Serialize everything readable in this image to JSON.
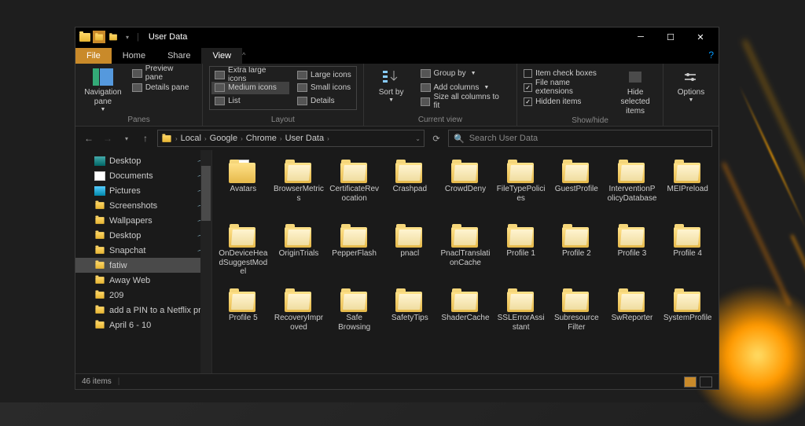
{
  "window": {
    "title": "User Data"
  },
  "tabs": {
    "file": "File",
    "home": "Home",
    "share": "Share",
    "view": "View"
  },
  "ribbon": {
    "panes": {
      "label": "Panes",
      "navigation": "Navigation pane",
      "preview": "Preview pane",
      "details": "Details pane"
    },
    "layout": {
      "label": "Layout",
      "extra_large": "Extra large icons",
      "large": "Large icons",
      "medium": "Medium icons",
      "small": "Small icons",
      "list": "List",
      "details": "Details"
    },
    "current_view": {
      "label": "Current view",
      "sort": "Sort by",
      "group": "Group by",
      "add_cols": "Add columns",
      "size_cols": "Size all columns to fit"
    },
    "show_hide": {
      "label": "Show/hide",
      "item_check": "Item check boxes",
      "ext": "File name extensions",
      "hidden": "Hidden items",
      "hide_selected": "Hide selected items"
    },
    "options": "Options"
  },
  "breadcrumb": [
    "Local",
    "Google",
    "Chrome",
    "User Data"
  ],
  "search": {
    "placeholder": "Search User Data"
  },
  "sidebar": [
    {
      "label": "Desktop",
      "icon": "desktop",
      "pin": true
    },
    {
      "label": "Documents",
      "icon": "doc",
      "pin": true
    },
    {
      "label": "Pictures",
      "icon": "pic",
      "pin": true
    },
    {
      "label": "Screenshots",
      "icon": "folder",
      "pin": true
    },
    {
      "label": "Wallpapers",
      "icon": "folder",
      "pin": true
    },
    {
      "label": "Desktop",
      "icon": "folder",
      "pin": true
    },
    {
      "label": "Snapchat",
      "icon": "folder",
      "pin": true
    },
    {
      "label": "fatiw",
      "icon": "folder",
      "pin": false,
      "selected": true
    },
    {
      "label": "Away Web",
      "icon": "folder",
      "pin": false
    },
    {
      "label": "209",
      "icon": "folder",
      "pin": false
    },
    {
      "label": "add a PIN to a Netflix profi",
      "icon": "folder",
      "pin": false
    },
    {
      "label": "April 6 - 10",
      "icon": "folder",
      "pin": false
    }
  ],
  "items": [
    "Avatars",
    "BrowserMetrics",
    "CertificateRevocation",
    "Crashpad",
    "CrowdDeny",
    "FileTypePolicies",
    "GuestProfile",
    "InterventionPolicyDatabase",
    "MEIPreload",
    "OnDeviceHeadSuggestModel",
    "OriginTrials",
    "PepperFlash",
    "pnacl",
    "PnaclTranslationCache",
    "Profile 1",
    "Profile 2",
    "Profile 3",
    "Profile 4",
    "Profile 5",
    "RecoveryImproved",
    "Safe Browsing",
    "SafetyTips",
    "ShaderCache",
    "SSLErrorAssistant",
    "Subresource Filter",
    "SwReporter",
    "SystemProfile"
  ],
  "status": {
    "count": "46 items"
  }
}
